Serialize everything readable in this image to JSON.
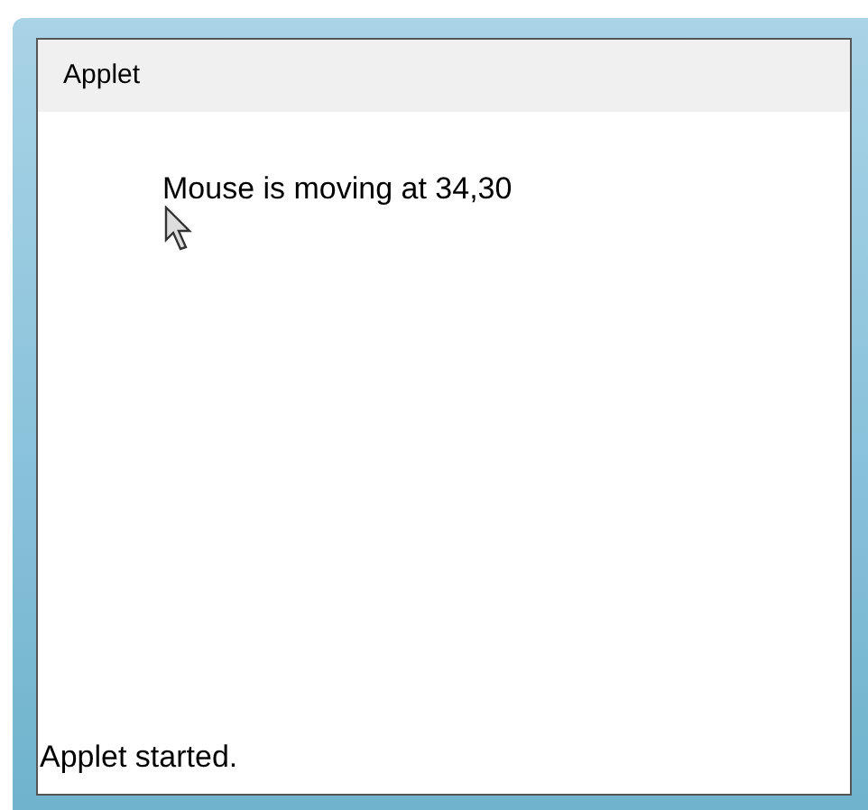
{
  "window": {
    "menu": [
      "Applet"
    ]
  },
  "canvas": {
    "message": "Mouse is moving at 34,30"
  },
  "status_bar": "Applet started."
}
